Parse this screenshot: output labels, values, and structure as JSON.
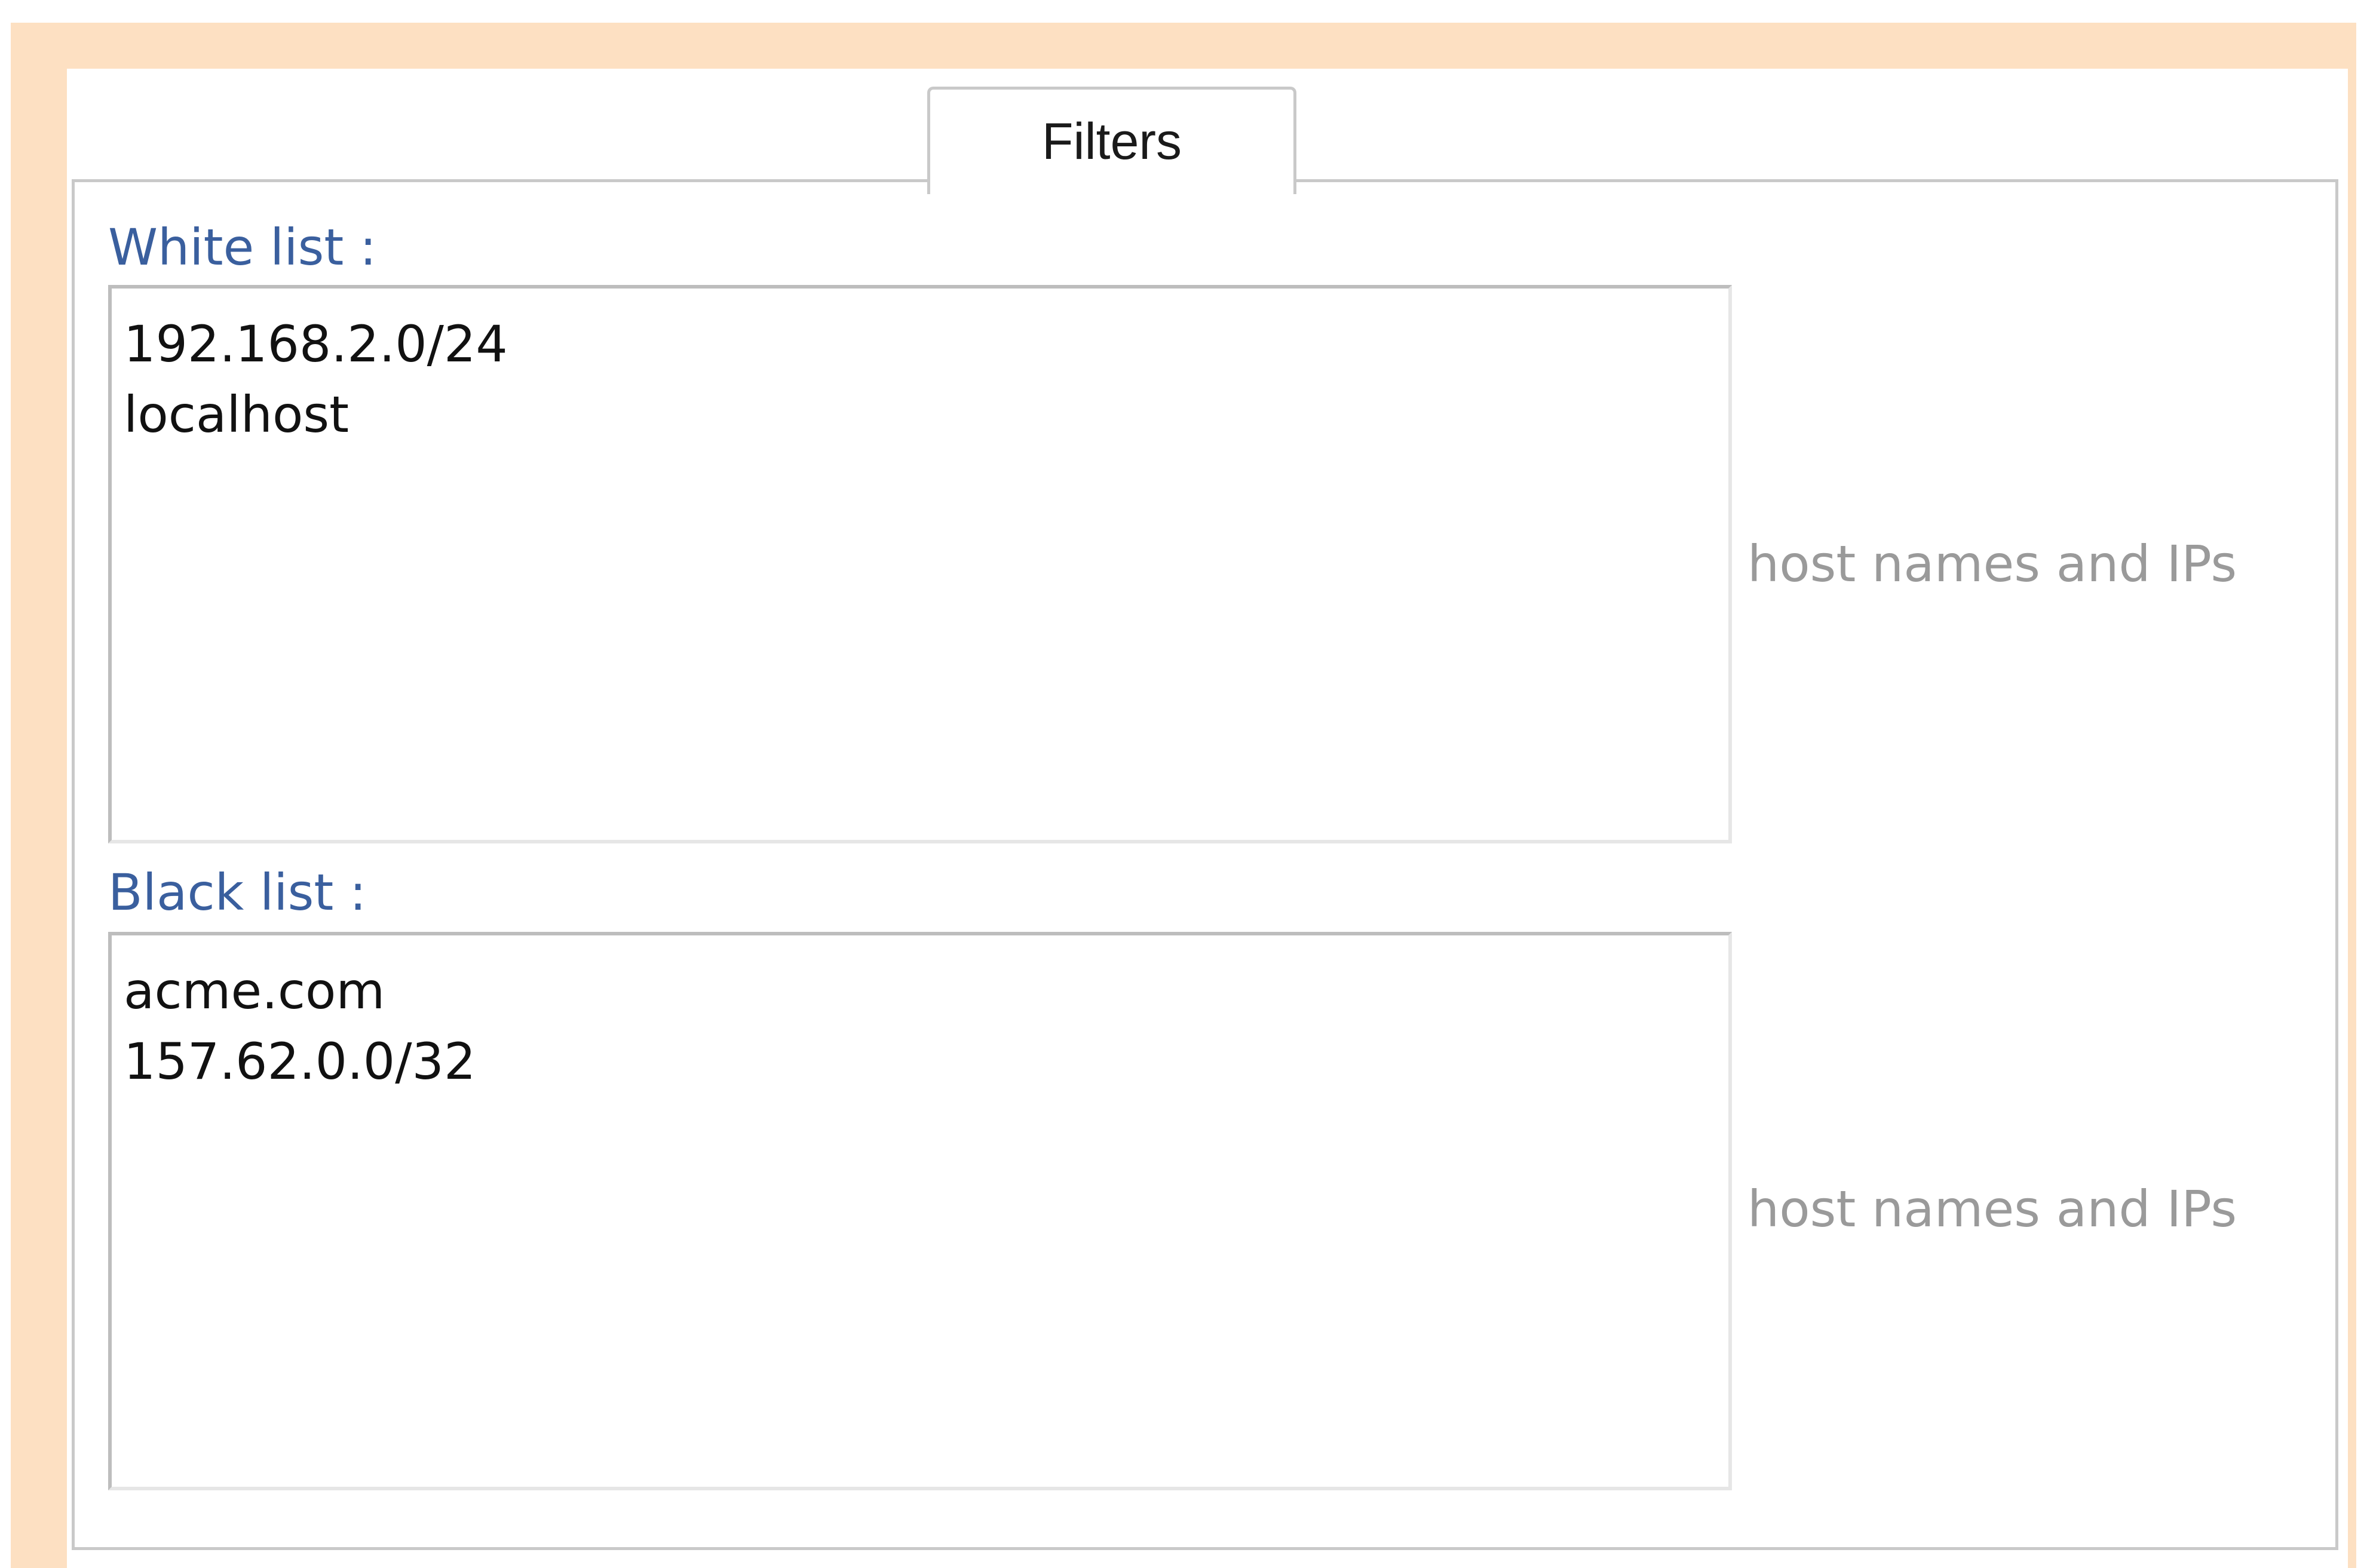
{
  "tabs": [
    {
      "label": "Filters",
      "active": true
    }
  ],
  "white_list": {
    "label": "White list :",
    "entries": [
      "192.168.2.0/24",
      "localhost"
    ],
    "hint": "host names and IPs"
  },
  "black_list": {
    "label": "Black list :",
    "entries": [
      "acme.com",
      "157.62.0.0/32"
    ],
    "hint": "host names and IPs"
  },
  "colors": {
    "frame": "#fde0c2",
    "label": "#3a5f9e",
    "hint": "#9a9a9a",
    "border": "#c9c9c9"
  }
}
